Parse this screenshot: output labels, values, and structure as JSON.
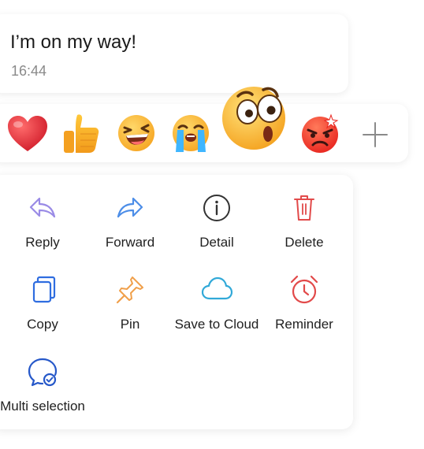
{
  "message": {
    "text": "I’m on my way!",
    "time": "16:44"
  },
  "reactions": {
    "items": [
      {
        "name": "red-heart"
      },
      {
        "name": "thumbs-up"
      },
      {
        "name": "laughing-face"
      },
      {
        "name": "loudly-crying-face"
      },
      {
        "name": "shocked-face",
        "selected": true
      },
      {
        "name": "angry-face"
      }
    ],
    "more_icon": "plus-icon"
  },
  "actions": {
    "reply": {
      "label": "Reply",
      "icon": "reply-arrow-icon",
      "color": "#9a8be6"
    },
    "forward": {
      "label": "Forward",
      "icon": "forward-arrow-icon",
      "color": "#4d8ee8"
    },
    "detail": {
      "label": "Detail",
      "icon": "info-icon",
      "color": "#333333"
    },
    "delete": {
      "label": "Delete",
      "icon": "trash-icon",
      "color": "#e24a4a"
    },
    "copy": {
      "label": "Copy",
      "icon": "copy-icon",
      "color": "#2f6de0"
    },
    "pin": {
      "label": "Pin",
      "icon": "pin-icon",
      "color": "#f0a04b"
    },
    "save_to_cloud": {
      "label": "Save to Cloud",
      "icon": "cloud-icon",
      "color": "#31a9d8"
    },
    "reminder": {
      "label": "Reminder",
      "icon": "alarm-clock-icon",
      "color": "#e24a4a"
    },
    "multi_selection": {
      "label": "Multi selection",
      "icon": "chat-check-icon",
      "color": "#2658c9"
    }
  }
}
